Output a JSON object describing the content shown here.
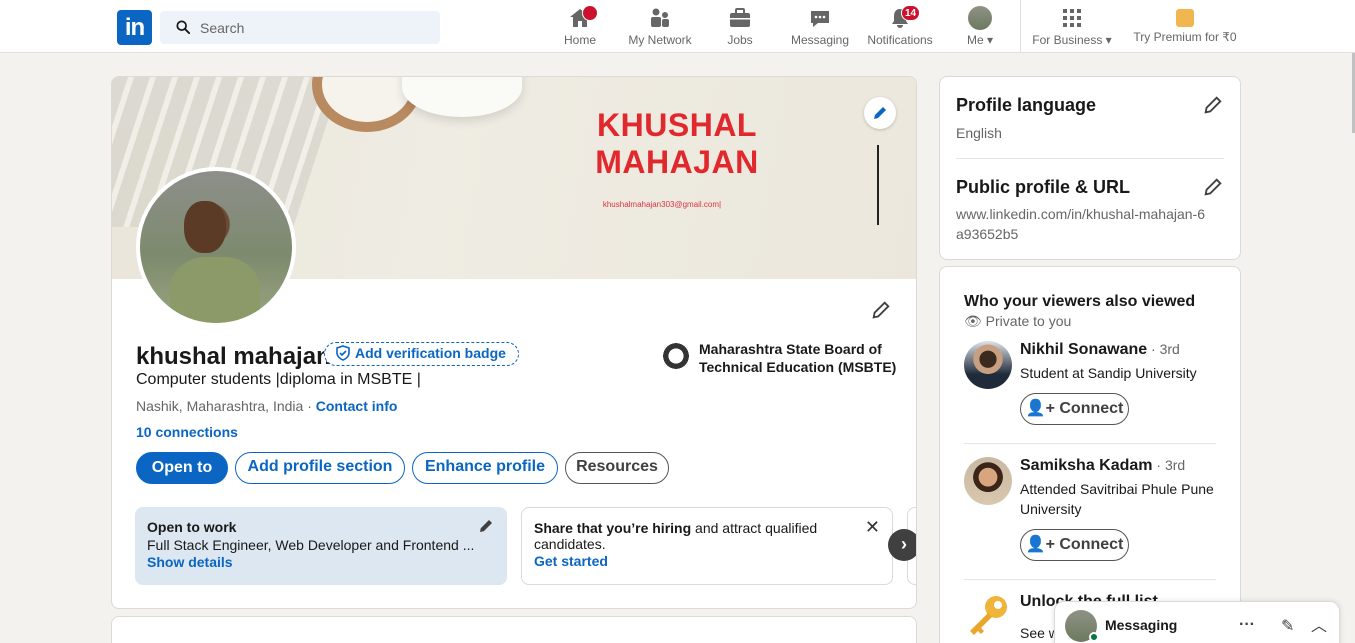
{
  "nav": {
    "search_placeholder": "Search",
    "items": [
      {
        "label": "Home",
        "badge": ""
      },
      {
        "label": "My Network",
        "badge": ""
      },
      {
        "label": "Jobs",
        "badge": ""
      },
      {
        "label": "Messaging",
        "badge": ""
      },
      {
        "label": "Notifications",
        "badge": "14"
      },
      {
        "label": "Me",
        "badge": ""
      },
      {
        "label": "For Business",
        "badge": ""
      },
      {
        "label": "Try Premium for ₹0",
        "badge": ""
      }
    ],
    "logo_text": "in"
  },
  "banner": {
    "title": "KHUSHAL MAHAJAN",
    "email": "khushalmahajan303@gmail.com|"
  },
  "profile": {
    "name": "khushal mahajan",
    "verify_label": "Add verification badge",
    "headline": "Computer students |diploma in MSBTE |",
    "location": "Nashik, Maharashtra, India",
    "location_sep": " · ",
    "contact_label": "Contact info",
    "connections": "10 connections",
    "education": "Maharashtra State Board of Technical Education (MSBTE)"
  },
  "buttons": {
    "open_to": "Open to",
    "add_section": "Add profile section",
    "enhance": "Enhance profile",
    "resources": "Resources"
  },
  "cards": {
    "open_to_work": {
      "title": "Open to work",
      "body": "Full Stack Engineer, Web Developer and Frontend ...",
      "link": "Show details"
    },
    "hiring": {
      "title": "Share that you’re hiring",
      "body_rest": " and attract qualified candidates.",
      "link": "Get started",
      "close": "✕"
    },
    "next": "›"
  },
  "right": {
    "profile_language": {
      "title": "Profile language",
      "value": "English"
    },
    "public_profile": {
      "title": "Public profile & URL",
      "value": "www.linkedin.com/in/khushal-mahajan-6a93652b5"
    },
    "viewers": {
      "title": "Who your viewers also viewed",
      "private": "Private to you",
      "people": [
        {
          "name": "Nikhil Sonawane",
          "degree": " · 3rd",
          "subtitle": "Student at Sandip University",
          "connect": "Connect"
        },
        {
          "name": "Samiksha Kadam",
          "degree": " · 3rd",
          "subtitle": "Attended Savitribai Phule Pune University",
          "connect": "Connect"
        }
      ],
      "unlock_partial": "Unlock the full list",
      "see_partial": "See w"
    }
  },
  "messaging": {
    "label": "Messaging",
    "more": "···",
    "compose": "✎",
    "collapse": "︿"
  },
  "colors": {
    "brand": "#0a66c2",
    "badge_red": "#cb112d",
    "banner_title": "#e0282d"
  }
}
